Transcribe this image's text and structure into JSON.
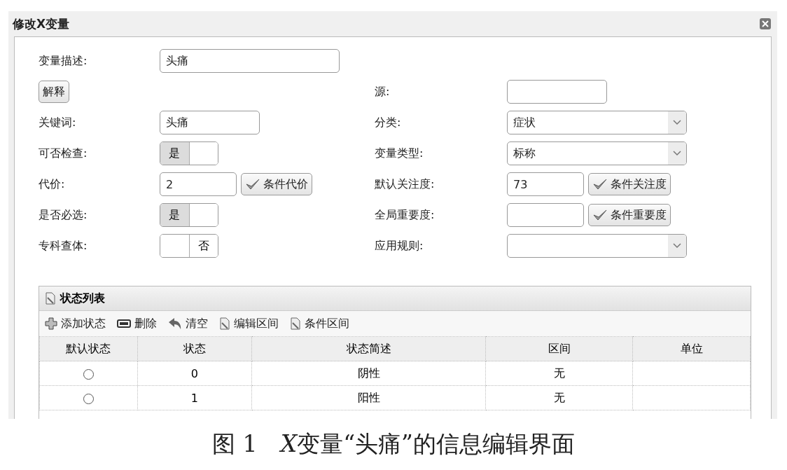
{
  "window": {
    "title": "修改X变量"
  },
  "form_rows": [
    {
      "left": {
        "kind": "wide_text",
        "label": "变量描述:",
        "value": "头痛"
      },
      "right": null
    },
    {
      "left": {
        "kind": "button",
        "text": "解释"
      },
      "right": {
        "kind": "text",
        "label": "源:"
      }
    },
    {
      "left": {
        "kind": "text",
        "label": "关键词:",
        "value": "头痛"
      },
      "right": {
        "kind": "select",
        "label": "分类:",
        "value": "症状"
      }
    },
    {
      "left": {
        "kind": "toggle",
        "label": "可否检查:",
        "text": "是",
        "on": true
      },
      "right": {
        "kind": "select",
        "label": "变量类型:",
        "value": "标称"
      }
    },
    {
      "left": {
        "kind": "number",
        "label": "代价:",
        "value": "2",
        "button": "条件代价"
      },
      "right": {
        "kind": "number",
        "label": "默认关注度:",
        "value": "73",
        "button": "条件关注度"
      }
    },
    {
      "left": {
        "kind": "toggle",
        "label": "是否必选:",
        "text": "是",
        "on": true
      },
      "right": {
        "kind": "number",
        "label": "全局重要度:",
        "button": "条件重要度"
      }
    },
    {
      "left": {
        "kind": "toggle",
        "label": "专科查体:",
        "text": "否",
        "on": false
      },
      "right": {
        "kind": "select",
        "label": "应用规则:"
      }
    }
  ],
  "state_list": {
    "title": "状态列表",
    "toolbar": [
      {
        "kind": "add",
        "label": "添加状态"
      },
      {
        "kind": "delete",
        "label": "删除"
      },
      {
        "kind": "clear",
        "label": "清空"
      },
      {
        "kind": "doc",
        "label": "编辑区间"
      },
      {
        "kind": "doc",
        "label": "条件区间"
      }
    ],
    "columns": [
      "默认状态",
      "状态",
      "状态简述",
      "区间",
      "单位"
    ],
    "rows": [
      {
        "selected": false,
        "state": "0",
        "description": "阴性",
        "interval": "无",
        "unit": ""
      },
      {
        "selected": false,
        "state": "1",
        "description": "阳性",
        "interval": "无",
        "unit": ""
      }
    ]
  },
  "caption": {
    "figure": "图 1",
    "variable": "X",
    "text": "变量“头痛”的信息编辑界面"
  }
}
